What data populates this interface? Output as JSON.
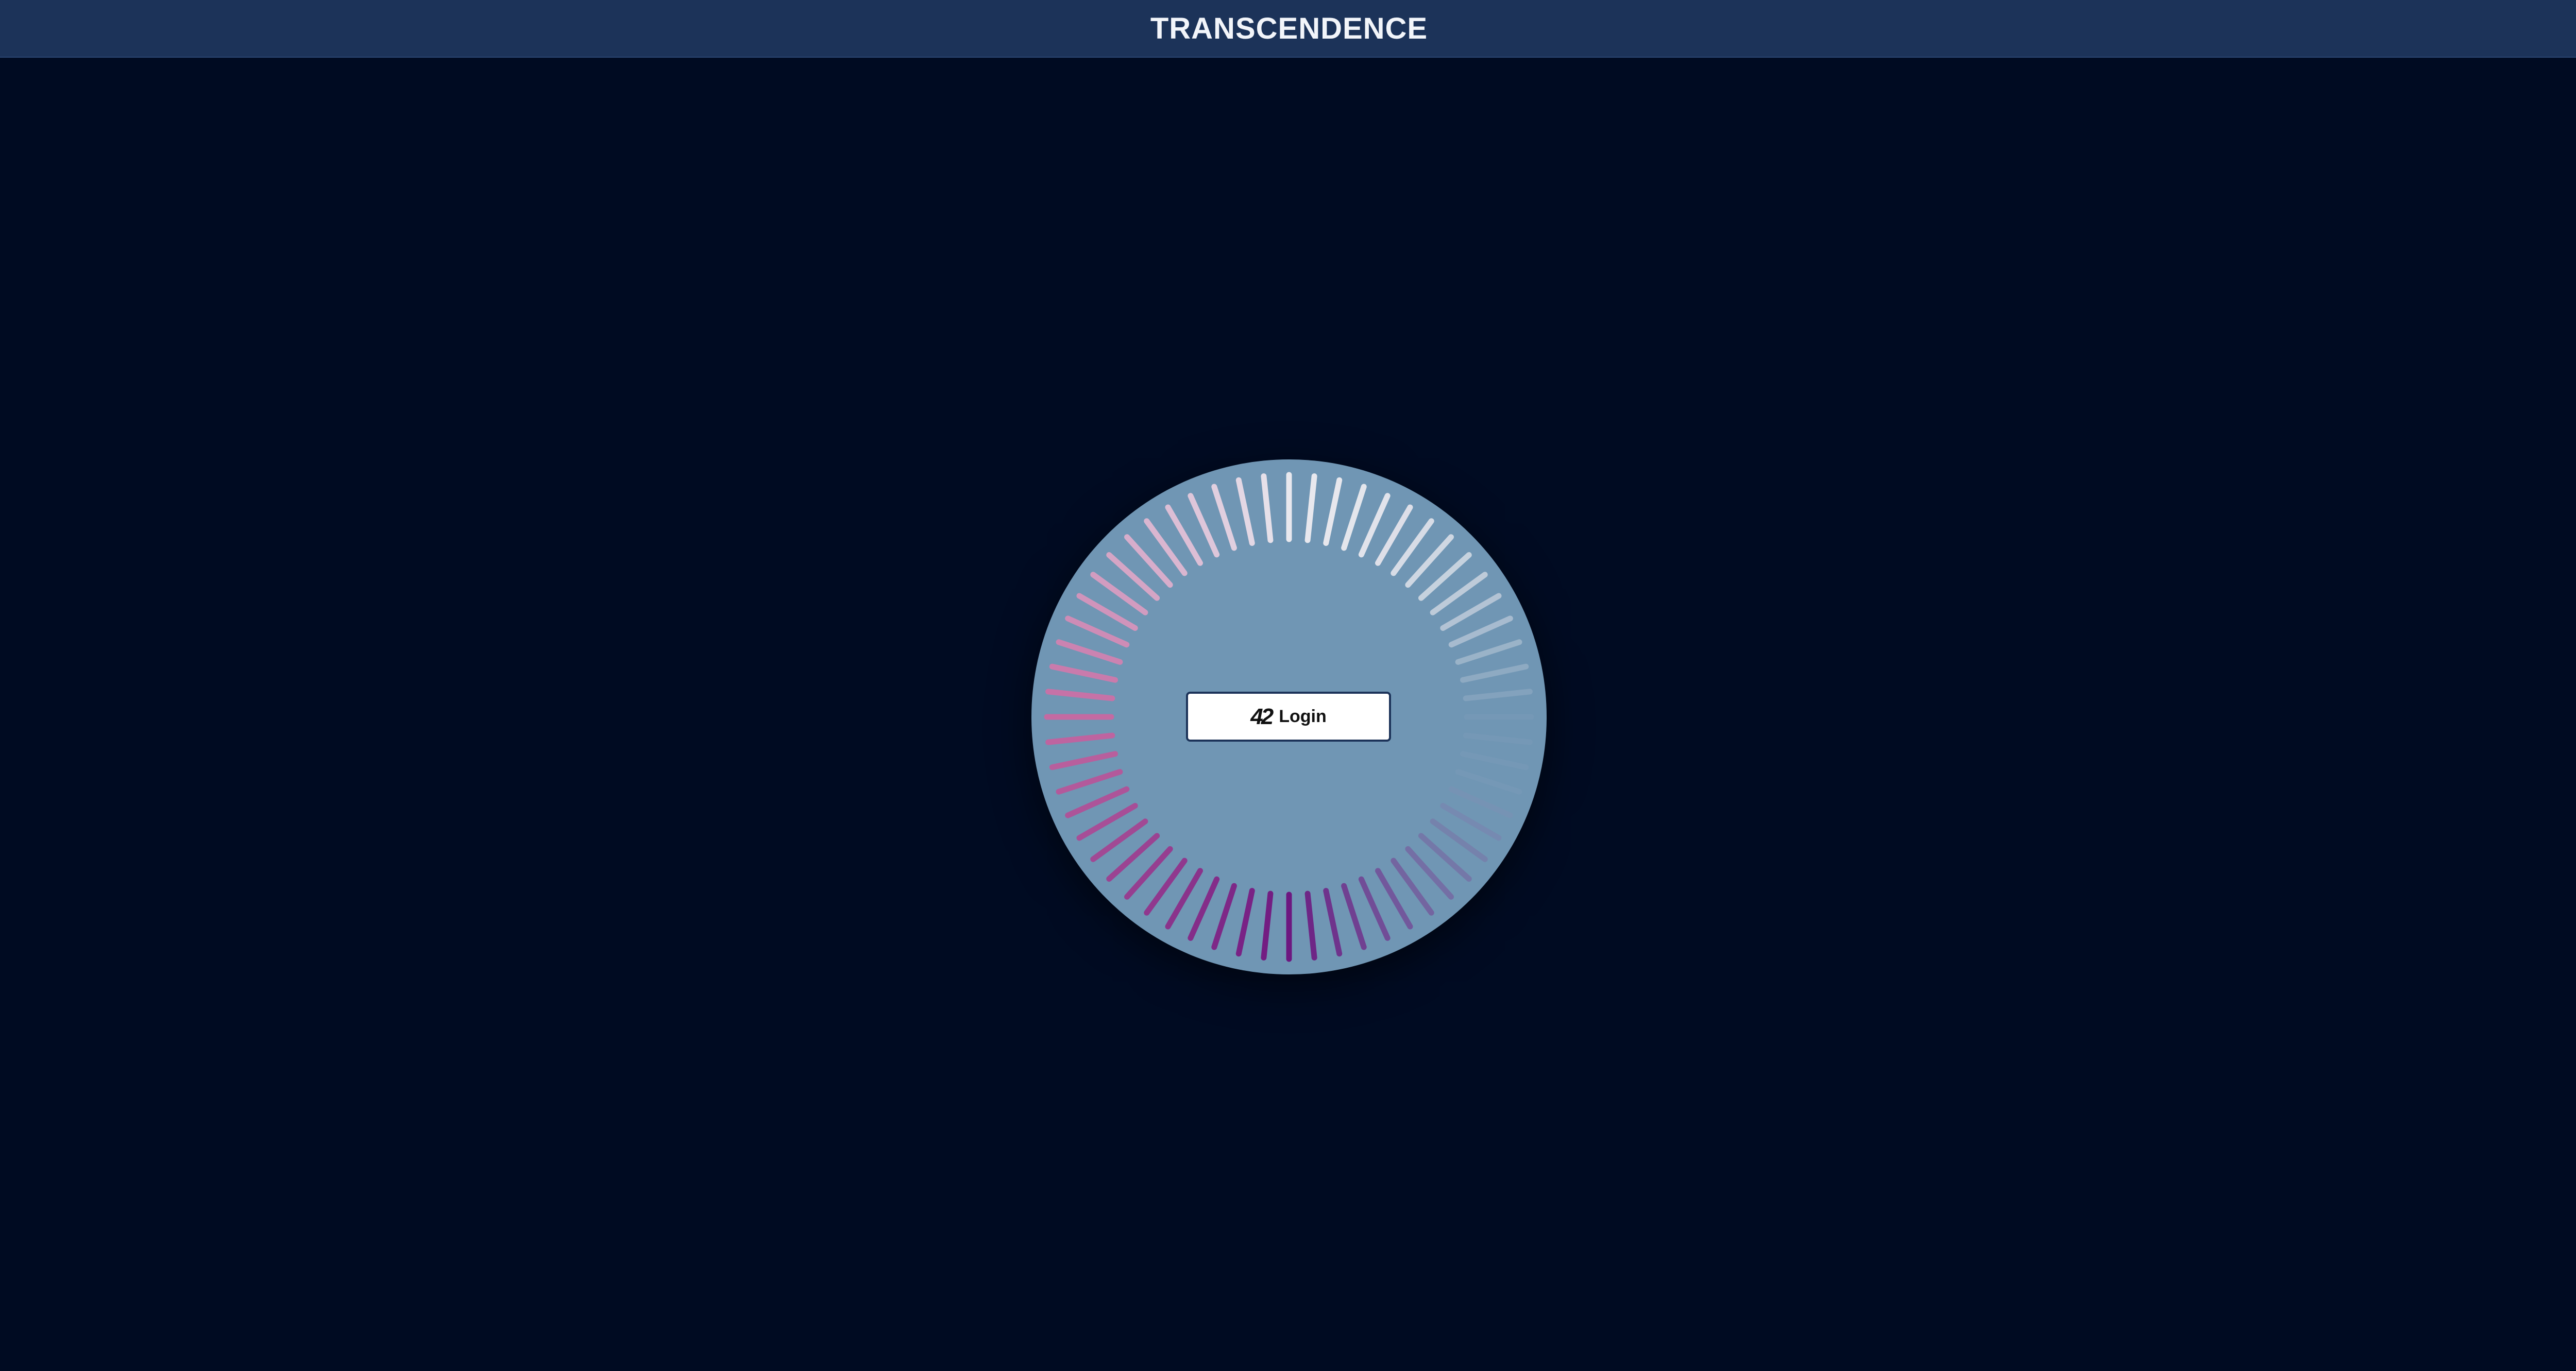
{
  "header": {
    "title": "TRANSCENDENCE"
  },
  "login": {
    "logo_text": "42",
    "label": "Login",
    "icon": "42-logo-icon"
  },
  "colors": {
    "background": "#000b22",
    "header": "#1c3359",
    "dial": "#7096b4",
    "tick_light": "#e6e6ee",
    "tick_pink": "#c0609c",
    "tick_purple": "#7a1c84"
  }
}
